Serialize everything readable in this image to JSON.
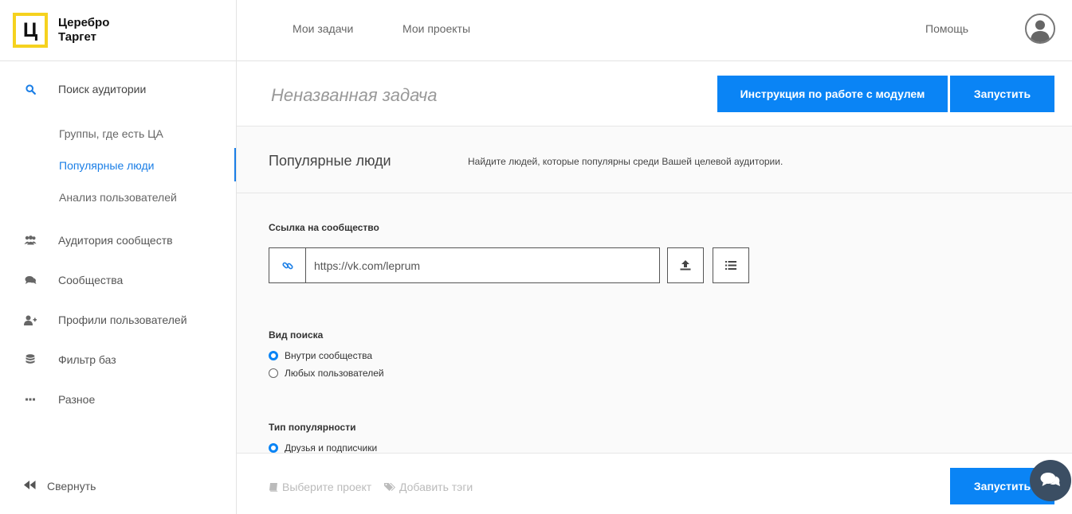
{
  "brand": {
    "logo_letter": "Ц",
    "name_line1": "Церебро",
    "name_line2": "Таргет"
  },
  "sidebar": {
    "search_section": {
      "label": "Поиск аудитории",
      "icon": "search-icon"
    },
    "sub_items": [
      {
        "label": "Группы, где есть ЦА"
      },
      {
        "label": "Популярные люди",
        "active": true
      },
      {
        "label": "Анализ пользователей"
      }
    ],
    "items": [
      {
        "label": "Аудитория сообществ",
        "icon": "users-icon"
      },
      {
        "label": "Сообщества",
        "icon": "comments-icon"
      },
      {
        "label": "Профили пользователей",
        "icon": "user-plus-icon"
      },
      {
        "label": "Фильтр баз",
        "icon": "database-icon"
      },
      {
        "label": "Разное",
        "icon": "more-icon"
      }
    ],
    "collapse_label": "Свернуть"
  },
  "topbar": {
    "links": [
      "Мои задачи",
      "Мои проекты"
    ],
    "help": "Помощь"
  },
  "task": {
    "title": "Неназванная задача",
    "instruction_button": "Инструкция по работе с модулем",
    "run_button": "Запустить"
  },
  "module": {
    "title": "Популярные люди",
    "description": "Найдите людей, которые популярны среди Вашей целевой аудитории."
  },
  "form": {
    "community_label": "Ссылка на сообщество",
    "community_value": "https://vk.com/leprum",
    "search_type_label": "Вид поиска",
    "search_type_options": [
      "Внутри сообщества",
      "Любых пользователей"
    ],
    "popularity_label": "Тип популярности",
    "popularity_options": [
      "Друзья и подписчики"
    ]
  },
  "footer": {
    "select_project": "Выберите проект",
    "add_tags": "Добавить тэги",
    "run_button": "Запустить"
  },
  "colors": {
    "accent": "#0a84f5",
    "active_link": "#1a7ee6",
    "logo_border": "#f5d21f",
    "chat": "#3b4e63"
  }
}
